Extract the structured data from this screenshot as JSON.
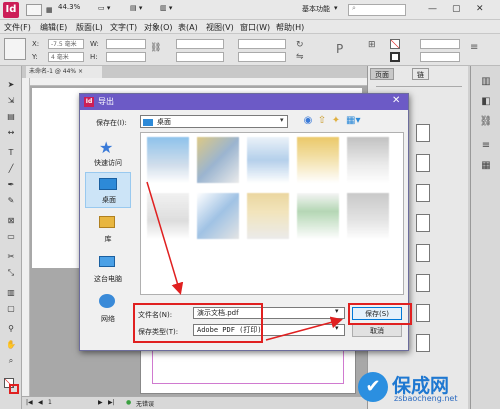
{
  "app": {
    "logo": "Id",
    "zoom": "44.3%",
    "workspace": "基本功能",
    "menu": [
      "文件(F)",
      "编辑(E)",
      "版面(L)",
      "文字(T)",
      "对象(O)",
      "表(A)",
      "视图(V)",
      "窗口(W)",
      "帮助(H)"
    ]
  },
  "control": {
    "x_label": "X:",
    "x_value": "-7.5 毫米",
    "y_label": "Y:",
    "y_value": "4 毫米",
    "w_label": "W:",
    "h_label": "H:"
  },
  "document": {
    "tab_label": "未命名-1 @ 44% ×",
    "status_page": "1",
    "status_error": "无错误"
  },
  "panels": {
    "tab_pages": "页面",
    "tab_layers": "链"
  },
  "dialog": {
    "title": "导出",
    "save_in_label": "保存在(I):",
    "save_in_value": "桌面",
    "places": [
      "快速访问",
      "桌面",
      "库",
      "这台电脑",
      "网络"
    ],
    "filename_label": "文件名(N):",
    "filename_value": "演示文档.pdf",
    "filetype_label": "保存类型(T):",
    "filetype_value": "Adobe PDF (打印)",
    "save_button": "保存(S)",
    "cancel_button": "取消"
  },
  "watermark": {
    "brand": "保成网",
    "url": "zsbaocheng.net",
    "badge": "✔"
  },
  "colors": {
    "title_bar": "#6c5ac6",
    "annotation": "#e02020",
    "brand": "#1f78d1"
  }
}
